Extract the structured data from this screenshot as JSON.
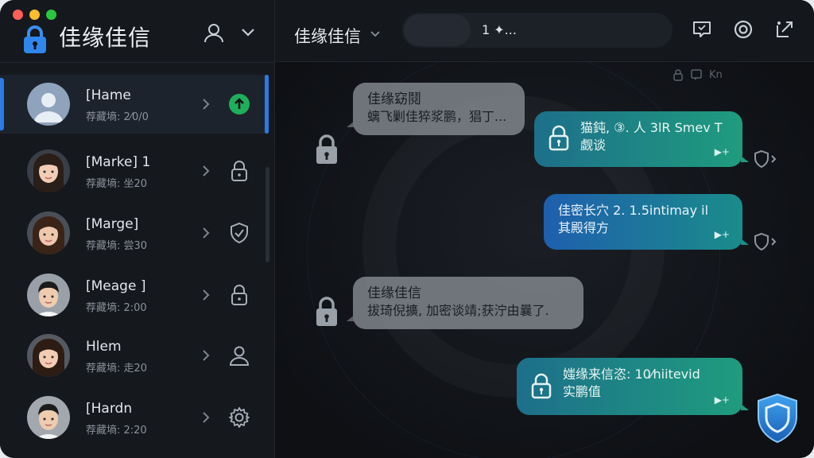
{
  "app": {
    "title": "佳缘佳信"
  },
  "sidebar": {
    "contacts": [
      {
        "name": "[Hame",
        "sub": "荐藏墒: 2⁄0/0",
        "status_icon": "arrow-up-circle-icon",
        "active": true
      },
      {
        "name": "[Marke] 1",
        "sub": "荐藏墒: 坐20",
        "status_icon": "lock-icon",
        "active": false
      },
      {
        "name": "[Marge]",
        "sub": "荐藏墒: 尝30",
        "status_icon": "shield-check-icon",
        "active": false
      },
      {
        "name": "[Meage ]",
        "sub": "荐藏墒: 2:00",
        "status_icon": "lock-icon",
        "active": false
      },
      {
        "name": "Hlem",
        "sub": "荐藏墒: 走20",
        "status_icon": "user-icon",
        "active": false
      },
      {
        "name": "[Hardn",
        "sub": "荐藏墒: 2:20",
        "status_icon": "gear-icon",
        "active": false
      }
    ]
  },
  "chat": {
    "title": "佳缘佳信",
    "search_text": "1 ✦...",
    "small_header": "Kn",
    "messages": [
      {
        "direction": "in",
        "title": "佳缘窈鬩",
        "text": "螭飞剿佳猝浆鹏，猖丁..."
      },
      {
        "direction": "out",
        "line1": "猫鈍,  ③. 人 3lR Smev T",
        "line2": "觑谈",
        "meta": "▶+"
      },
      {
        "direction": "out",
        "line1": "佳密长穴 2. 1.5intimay il",
        "line2": "其殿得方",
        "meta": "▶+"
      },
      {
        "direction": "in",
        "title": "佳缘佳信",
        "text": "拔琦倪擴, 加密谈靖;获泞由曩了."
      },
      {
        "direction": "out",
        "line1": "媸缘来信恣: 10⁄hiitevid",
        "line2": "实鹏值",
        "meta": "▶+"
      }
    ]
  },
  "colors": {
    "accent": "#2a7be4",
    "bubble_teal": "#1f9c7e",
    "bubble_blue": "#1f5fae",
    "online_green": "#1fae5b"
  }
}
